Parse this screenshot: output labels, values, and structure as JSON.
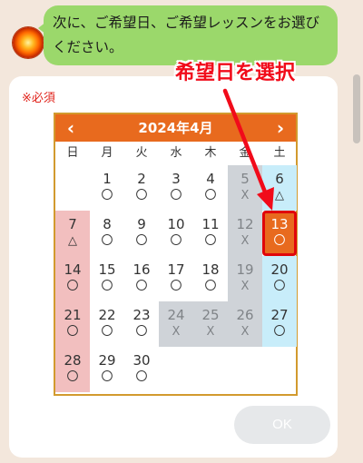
{
  "chat": {
    "message": "次に、ご希望日、ご希望レッスンをお選びください。"
  },
  "form": {
    "required_label": "※必須",
    "ok_label": "OK"
  },
  "calendar": {
    "title": "2024年4月",
    "prev_icon": "‹",
    "next_icon": "›",
    "weekdays": [
      "日",
      "月",
      "火",
      "水",
      "木",
      "金",
      "土"
    ],
    "days": [
      {
        "day": "",
        "mark": "",
        "col": 0,
        "row": 0,
        "status": "empty"
      },
      {
        "day": "1",
        "mark": "〇",
        "col": 1,
        "row": 0,
        "status": "available"
      },
      {
        "day": "2",
        "mark": "〇",
        "col": 2,
        "row": 0,
        "status": "available"
      },
      {
        "day": "3",
        "mark": "〇",
        "col": 3,
        "row": 0,
        "status": "available"
      },
      {
        "day": "4",
        "mark": "〇",
        "col": 4,
        "row": 0,
        "status": "available"
      },
      {
        "day": "5",
        "mark": "X",
        "col": 5,
        "row": 0,
        "status": "closed"
      },
      {
        "day": "6",
        "mark": "△",
        "col": 6,
        "row": 0,
        "status": "saturday"
      },
      {
        "day": "7",
        "mark": "△",
        "col": 0,
        "row": 1,
        "status": "sunday"
      },
      {
        "day": "8",
        "mark": "〇",
        "col": 1,
        "row": 1,
        "status": "available"
      },
      {
        "day": "9",
        "mark": "〇",
        "col": 2,
        "row": 1,
        "status": "available"
      },
      {
        "day": "10",
        "mark": "〇",
        "col": 3,
        "row": 1,
        "status": "available"
      },
      {
        "day": "11",
        "mark": "〇",
        "col": 4,
        "row": 1,
        "status": "available"
      },
      {
        "day": "12",
        "mark": "X",
        "col": 5,
        "row": 1,
        "status": "closed"
      },
      {
        "day": "13",
        "mark": "〇",
        "col": 6,
        "row": 1,
        "status": "selected"
      },
      {
        "day": "14",
        "mark": "〇",
        "col": 0,
        "row": 2,
        "status": "sunday"
      },
      {
        "day": "15",
        "mark": "〇",
        "col": 1,
        "row": 2,
        "status": "available"
      },
      {
        "day": "16",
        "mark": "〇",
        "col": 2,
        "row": 2,
        "status": "available"
      },
      {
        "day": "17",
        "mark": "〇",
        "col": 3,
        "row": 2,
        "status": "available"
      },
      {
        "day": "18",
        "mark": "〇",
        "col": 4,
        "row": 2,
        "status": "available"
      },
      {
        "day": "19",
        "mark": "X",
        "col": 5,
        "row": 2,
        "status": "closed"
      },
      {
        "day": "20",
        "mark": "〇",
        "col": 6,
        "row": 2,
        "status": "saturday"
      },
      {
        "day": "21",
        "mark": "〇",
        "col": 0,
        "row": 3,
        "status": "sunday"
      },
      {
        "day": "22",
        "mark": "〇",
        "col": 1,
        "row": 3,
        "status": "available"
      },
      {
        "day": "23",
        "mark": "〇",
        "col": 2,
        "row": 3,
        "status": "available"
      },
      {
        "day": "24",
        "mark": "X",
        "col": 3,
        "row": 3,
        "status": "closed"
      },
      {
        "day": "25",
        "mark": "X",
        "col": 4,
        "row": 3,
        "status": "closed"
      },
      {
        "day": "26",
        "mark": "X",
        "col": 5,
        "row": 3,
        "status": "closed"
      },
      {
        "day": "27",
        "mark": "〇",
        "col": 6,
        "row": 3,
        "status": "saturday"
      },
      {
        "day": "28",
        "mark": "〇",
        "col": 0,
        "row": 4,
        "status": "sunday"
      },
      {
        "day": "29",
        "mark": "〇",
        "col": 1,
        "row": 4,
        "status": "available"
      },
      {
        "day": "30",
        "mark": "〇",
        "col": 2,
        "row": 4,
        "status": "available"
      }
    ]
  },
  "annotation": {
    "text": "希望日を選択"
  },
  "colors": {
    "header": "#e86a1e",
    "sunday": "#f2bfbf",
    "saturday": "#c8edfa",
    "closed": "#cfd3d8",
    "selected_border": "#e0060b",
    "annotation": "#f10b1a"
  }
}
